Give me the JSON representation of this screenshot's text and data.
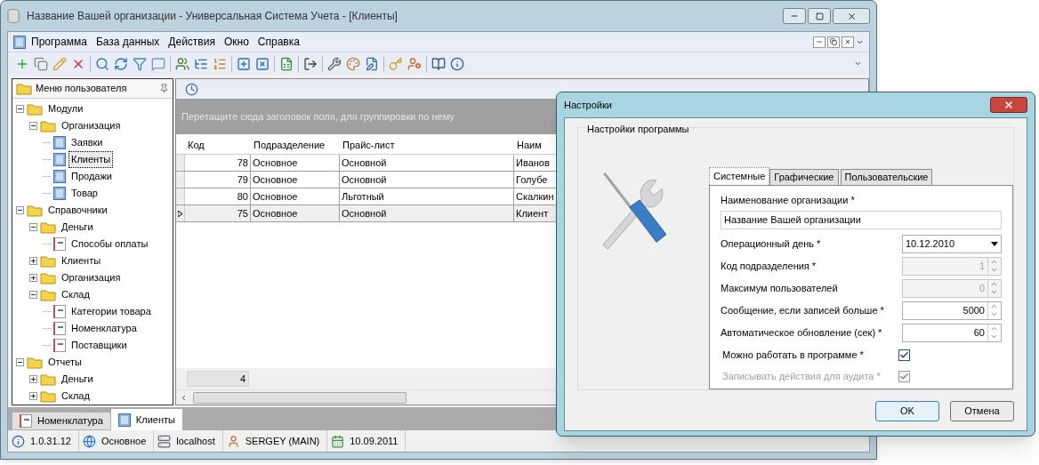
{
  "window": {
    "title": "Название Вашей организации - Универсальная Система Учета - [Клиенты]"
  },
  "menu": [
    "Программа",
    "База данных",
    "Действия",
    "Окно",
    "Справка"
  ],
  "side_panel": {
    "title": "Меню пользователя",
    "tree": [
      {
        "label": "Модули",
        "kind": "folder",
        "expanded": true,
        "selected": false,
        "children": [
          {
            "label": "Организация",
            "kind": "folder",
            "expanded": true,
            "selected": false,
            "children": [
              {
                "label": "Заявки",
                "kind": "form",
                "selected": false
              },
              {
                "label": "Клиенты",
                "kind": "form",
                "selected": true
              },
              {
                "label": "Продажи",
                "kind": "form",
                "selected": false
              },
              {
                "label": "Товар",
                "kind": "form",
                "selected": false
              }
            ]
          }
        ]
      },
      {
        "label": "Справочники",
        "kind": "folder",
        "expanded": true,
        "selected": false,
        "children": [
          {
            "label": "Деньги",
            "kind": "folder",
            "expanded": true,
            "selected": false,
            "children": [
              {
                "label": "Способы оплаты",
                "kind": "list",
                "selected": false
              }
            ]
          },
          {
            "label": "Клиенты",
            "kind": "folder",
            "expanded": false,
            "selected": false
          },
          {
            "label": "Организация",
            "kind": "folder",
            "expanded": false,
            "selected": false
          },
          {
            "label": "Склад",
            "kind": "folder",
            "expanded": true,
            "selected": false,
            "children": [
              {
                "label": "Категории товара",
                "kind": "list",
                "selected": false
              },
              {
                "label": "Номенклатура",
                "kind": "list",
                "selected": false
              },
              {
                "label": "Поставщики",
                "kind": "list",
                "selected": false
              }
            ]
          }
        ]
      },
      {
        "label": "Отчеты",
        "kind": "folder",
        "expanded": true,
        "selected": false,
        "children": [
          {
            "label": "Деньги",
            "kind": "folder",
            "expanded": false,
            "selected": false
          },
          {
            "label": "Склад",
            "kind": "folder",
            "expanded": false,
            "selected": false
          }
        ]
      }
    ]
  },
  "grid": {
    "group_hint": "Перетащите сюда заголовок поля, для группировки по нему",
    "columns": [
      "Код",
      "Подразделение",
      "Прайс-лист",
      "Наим"
    ],
    "rows": [
      {
        "cells": [
          "78",
          "Основное",
          "Основной",
          "Иванов"
        ],
        "selected": false
      },
      {
        "cells": [
          "79",
          "Основное",
          "Основной",
          "Голубе"
        ],
        "selected": false
      },
      {
        "cells": [
          "80",
          "Основное",
          "Льготный",
          "Скалкин"
        ],
        "selected": false
      },
      {
        "cells": [
          "75",
          "Основное",
          "Основной",
          "Клиент"
        ],
        "selected": true
      }
    ],
    "footer_count": "4"
  },
  "document_tabs": [
    {
      "label": "Номенклатура",
      "kind": "list",
      "selected": false
    },
    {
      "label": "Клиенты",
      "kind": "form",
      "selected": true
    }
  ],
  "status_bar": [
    {
      "kind": "info",
      "text": "1.0.31.12"
    },
    {
      "kind": "globe",
      "text": "Основное"
    },
    {
      "kind": "server",
      "text": "localhost"
    },
    {
      "kind": "user",
      "text": "SERGEY (MAIN)"
    },
    {
      "kind": "calendar",
      "text": "10.09.2011"
    }
  ],
  "dialog": {
    "title": "Настройки",
    "group_title": "Настройки программы",
    "tabs": [
      {
        "label": "Системные",
        "selected": true
      },
      {
        "label": "Графические",
        "selected": false
      },
      {
        "label": "Пользовательские",
        "selected": false
      }
    ],
    "org_name_label": "Наименование организации *",
    "org_name_value": "Название Вашей организации",
    "fields": [
      {
        "kind": "date",
        "label": "Операционный день *",
        "value": "10.12.2010",
        "disabled": false
      },
      {
        "kind": "spin",
        "label": "Код подразделения *",
        "value": "1",
        "disabled": true
      },
      {
        "kind": "spin",
        "label": "Максимум пользователей",
        "value": "0",
        "disabled": true
      },
      {
        "kind": "spin",
        "label": "Сообщение, если записей больше *",
        "value": "5000",
        "disabled": false
      },
      {
        "kind": "spin",
        "label": "Автоматическое обновление (сек) *",
        "value": "60",
        "disabled": false
      },
      {
        "kind": "checkbox",
        "label": "Можно работать в программе *",
        "checked": true,
        "disabled": false
      },
      {
        "kind": "checkbox",
        "label": "Записывать действия для аудита *",
        "checked": true,
        "disabled": true
      }
    ],
    "buttons": [
      "OK",
      "Отмена"
    ]
  }
}
